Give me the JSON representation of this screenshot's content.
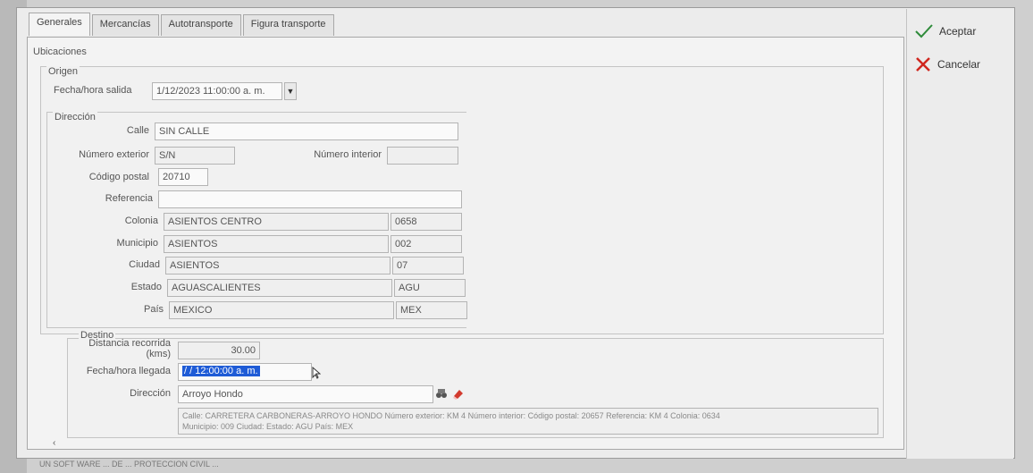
{
  "tabs": [
    "Generales",
    "Mercancías",
    "Autotransporte",
    "Figura transporte"
  ],
  "ubicaciones_label": "Ubicaciones",
  "origen": {
    "label": "Origen",
    "fecha_label": "Fecha/hora salida",
    "fecha_value": "1/12/2023 11:00:00 a. m."
  },
  "direccion": {
    "label": "Dirección",
    "calle_label": "Calle",
    "calle_value": "SIN CALLE",
    "num_ext_label": "Número exterior",
    "num_ext_value": "S/N",
    "num_int_label": "Número interior",
    "num_int_value": "",
    "cp_label": "Código postal",
    "cp_value": "20710",
    "referencia_label": "Referencia",
    "referencia_value": "",
    "colonia_label": "Colonia",
    "colonia_value": "ASIENTOS CENTRO",
    "colonia_code": "0658",
    "municipio_label": "Municipio",
    "municipio_value": "ASIENTOS",
    "municipio_code": "002",
    "ciudad_label": "Ciudad",
    "ciudad_value": "ASIENTOS",
    "ciudad_code": "07",
    "estado_label": "Estado",
    "estado_value": "AGUASCALIENTES",
    "estado_code": "AGU",
    "pais_label": "País",
    "pais_value": "MEXICO",
    "pais_code": "MEX"
  },
  "destino": {
    "label": "Destino",
    "distancia_label_1": "Distancia recorrida",
    "distancia_label_2": "(kms)",
    "distancia_value": "30.00",
    "fecha_label": "Fecha/hora llegada",
    "fecha_value": "/ /     12:00:00 a. m.",
    "direccion_label": "Dirección",
    "direccion_value": "Arroyo Hondo",
    "detalle_line1": "Calle: CARRETERA CARBONERAS-ARROYO HONDO Número exterior: KM 4 Número interior:  Código postal: 20657 Referencia: KM 4 Colonia: 0634",
    "detalle_line2": "Municipio: 009 Ciudad:  Estado: AGU País: MEX"
  },
  "actions": {
    "aceptar": "Aceptar",
    "cancelar": "Cancelar"
  },
  "status_text": "UN SOFT WARE ... DE ... PROTECCION CIVIL ...",
  "colors": {
    "selection": "#1e5bd6",
    "check": "#2e8b3a",
    "cancel": "#d0271f"
  },
  "icons": [
    "check-icon",
    "x-icon",
    "dropdown-arrow-icon",
    "binoculars-icon",
    "eraser-icon",
    "row-pointer-icon",
    "scroll-left-icon"
  ]
}
